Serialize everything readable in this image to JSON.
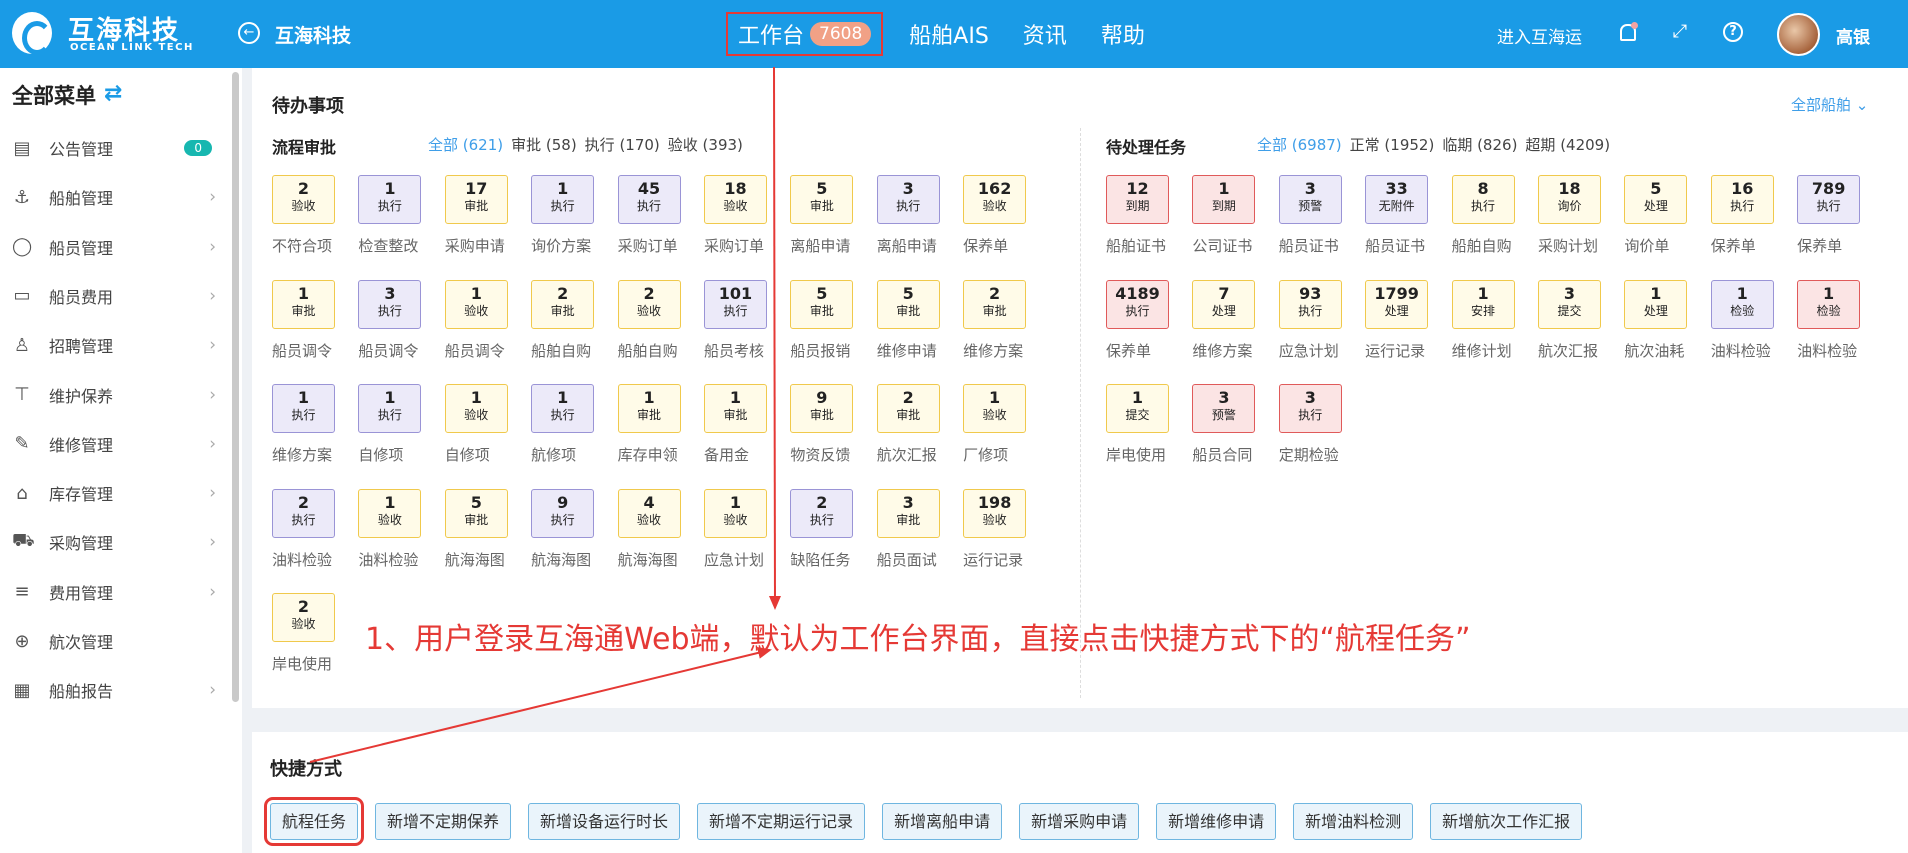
{
  "header": {
    "brand_cn": "互海科技",
    "brand_en": "OCEAN LINK TECH",
    "org_name": "互海科技",
    "nav": [
      {
        "label": "工作台",
        "badge": "7608"
      },
      {
        "label": "船舶AIS"
      },
      {
        "label": "资讯"
      },
      {
        "label": "帮助"
      }
    ],
    "enter_link": "进入互海运",
    "user_name": "高银"
  },
  "sidebar": {
    "title": "全部菜单",
    "items": [
      {
        "label": "公告管理",
        "icon": "book-icon",
        "badge": "0"
      },
      {
        "label": "船舶管理",
        "icon": "anchor-icon"
      },
      {
        "label": "船员管理",
        "icon": "user-icon"
      },
      {
        "label": "船员费用",
        "icon": "wallet-icon"
      },
      {
        "label": "招聘管理",
        "icon": "recruit-icon"
      },
      {
        "label": "维护保养",
        "icon": "hammer-icon"
      },
      {
        "label": "维修管理",
        "icon": "wrench-icon"
      },
      {
        "label": "库存管理",
        "icon": "warehouse-icon"
      },
      {
        "label": "采购管理",
        "icon": "cart-icon"
      },
      {
        "label": "费用管理",
        "icon": "coins-icon"
      },
      {
        "label": "航次管理",
        "icon": "globe-icon"
      },
      {
        "label": "船舶报告",
        "icon": "calendar-icon"
      }
    ]
  },
  "todo": {
    "title": "待办事项",
    "all_ships": "全部船舶",
    "approval": {
      "title": "流程审批",
      "filters": [
        "全部 (621)",
        "审批 (58)",
        "执行 (170)",
        "验收 (393)"
      ],
      "items": [
        {
          "n": "2",
          "t": "验收",
          "c": "不符合项",
          "color": "yellow"
        },
        {
          "n": "1",
          "t": "执行",
          "c": "检查整改",
          "color": "purple"
        },
        {
          "n": "17",
          "t": "审批",
          "c": "采购申请",
          "color": "yellow"
        },
        {
          "n": "1",
          "t": "执行",
          "c": "询价方案",
          "color": "purple"
        },
        {
          "n": "45",
          "t": "执行",
          "c": "采购订单",
          "color": "purple"
        },
        {
          "n": "18",
          "t": "验收",
          "c": "采购订单",
          "color": "yellow"
        },
        {
          "n": "5",
          "t": "审批",
          "c": "离船申请",
          "color": "yellow"
        },
        {
          "n": "3",
          "t": "执行",
          "c": "离船申请",
          "color": "purple"
        },
        {
          "n": "162",
          "t": "验收",
          "c": "保养单",
          "color": "yellow"
        },
        {
          "n": "1",
          "t": "审批",
          "c": "船员调令",
          "color": "yellow"
        },
        {
          "n": "3",
          "t": "执行",
          "c": "船员调令",
          "color": "purple"
        },
        {
          "n": "1",
          "t": "验收",
          "c": "船员调令",
          "color": "yellow"
        },
        {
          "n": "2",
          "t": "审批",
          "c": "船舶自购",
          "color": "yellow"
        },
        {
          "n": "2",
          "t": "验收",
          "c": "船舶自购",
          "color": "yellow"
        },
        {
          "n": "101",
          "t": "执行",
          "c": "船员考核",
          "color": "purple"
        },
        {
          "n": "5",
          "t": "审批",
          "c": "船员报销",
          "color": "yellow"
        },
        {
          "n": "5",
          "t": "审批",
          "c": "维修申请",
          "color": "yellow"
        },
        {
          "n": "2",
          "t": "审批",
          "c": "维修方案",
          "color": "yellow"
        },
        {
          "n": "1",
          "t": "执行",
          "c": "维修方案",
          "color": "purple"
        },
        {
          "n": "1",
          "t": "执行",
          "c": "自修项",
          "color": "purple"
        },
        {
          "n": "1",
          "t": "验收",
          "c": "自修项",
          "color": "yellow"
        },
        {
          "n": "1",
          "t": "执行",
          "c": "航修项",
          "color": "purple"
        },
        {
          "n": "1",
          "t": "审批",
          "c": "库存申领",
          "color": "yellow"
        },
        {
          "n": "1",
          "t": "审批",
          "c": "备用金",
          "color": "yellow"
        },
        {
          "n": "9",
          "t": "审批",
          "c": "物资反馈",
          "color": "yellow"
        },
        {
          "n": "2",
          "t": "审批",
          "c": "航次汇报",
          "color": "yellow"
        },
        {
          "n": "1",
          "t": "验收",
          "c": "厂修项",
          "color": "yellow"
        },
        {
          "n": "2",
          "t": "执行",
          "c": "油料检验",
          "color": "purple"
        },
        {
          "n": "1",
          "t": "验收",
          "c": "油料检验",
          "color": "yellow"
        },
        {
          "n": "5",
          "t": "审批",
          "c": "航海海图",
          "color": "yellow"
        },
        {
          "n": "9",
          "t": "执行",
          "c": "航海海图",
          "color": "purple"
        },
        {
          "n": "4",
          "t": "验收",
          "c": "航海海图",
          "color": "yellow"
        },
        {
          "n": "1",
          "t": "验收",
          "c": "应急计划",
          "color": "yellow"
        },
        {
          "n": "2",
          "t": "执行",
          "c": "缺陷任务",
          "color": "purple"
        },
        {
          "n": "3",
          "t": "审批",
          "c": "船员面试",
          "color": "yellow"
        },
        {
          "n": "198",
          "t": "验收",
          "c": "运行记录",
          "color": "yellow"
        },
        {
          "n": "2",
          "t": "验收",
          "c": "岸电使用",
          "color": "yellow"
        }
      ]
    },
    "tasks": {
      "title": "待处理任务",
      "filters": [
        "全部 (6987)",
        "正常 (1952)",
        "临期 (826)",
        "超期 (4209)"
      ],
      "items": [
        {
          "n": "12",
          "t": "到期",
          "c": "船舶证书",
          "color": "red"
        },
        {
          "n": "1",
          "t": "到期",
          "c": "公司证书",
          "color": "red"
        },
        {
          "n": "3",
          "t": "预警",
          "c": "船员证书",
          "color": "purple"
        },
        {
          "n": "33",
          "t": "无附件",
          "c": "船员证书",
          "color": "purple"
        },
        {
          "n": "8",
          "t": "执行",
          "c": "船舶自购",
          "color": "yellow"
        },
        {
          "n": "18",
          "t": "询价",
          "c": "采购计划",
          "color": "yellow"
        },
        {
          "n": "5",
          "t": "处理",
          "c": "询价单",
          "color": "yellow"
        },
        {
          "n": "16",
          "t": "执行",
          "c": "保养单",
          "color": "yellow"
        },
        {
          "n": "789",
          "t": "执行",
          "c": "保养单",
          "color": "purple"
        },
        {
          "n": "4189",
          "t": "执行",
          "c": "保养单",
          "color": "red"
        },
        {
          "n": "7",
          "t": "处理",
          "c": "维修方案",
          "color": "yellow"
        },
        {
          "n": "93",
          "t": "执行",
          "c": "应急计划",
          "color": "yellow"
        },
        {
          "n": "1799",
          "t": "处理",
          "c": "运行记录",
          "color": "yellow"
        },
        {
          "n": "1",
          "t": "安排",
          "c": "维修计划",
          "color": "yellow"
        },
        {
          "n": "3",
          "t": "提交",
          "c": "航次汇报",
          "color": "yellow"
        },
        {
          "n": "1",
          "t": "处理",
          "c": "航次油耗",
          "color": "yellow"
        },
        {
          "n": "1",
          "t": "检验",
          "c": "油料检验",
          "color": "purple"
        },
        {
          "n": "1",
          "t": "检验",
          "c": "油料检验",
          "color": "red"
        },
        {
          "n": "1",
          "t": "提交",
          "c": "岸电使用",
          "color": "yellow"
        },
        {
          "n": "3",
          "t": "预警",
          "c": "船员合同",
          "color": "red"
        },
        {
          "n": "3",
          "t": "执行",
          "c": "定期检验",
          "color": "red"
        }
      ]
    }
  },
  "quick": {
    "title": "快捷方式",
    "items": [
      "航程任务",
      "新增不定期保养",
      "新增设备运行时长",
      "新增不定期运行记录",
      "新增离船申请",
      "新增采购申请",
      "新增维修申请",
      "新增油料检测",
      "新增航次工作汇报"
    ]
  },
  "annotation": {
    "text": "1、用户登录互海通Web端，默认为工作台界面，直接点击快捷方式下的“航程任务”",
    "color": "#e53935"
  }
}
